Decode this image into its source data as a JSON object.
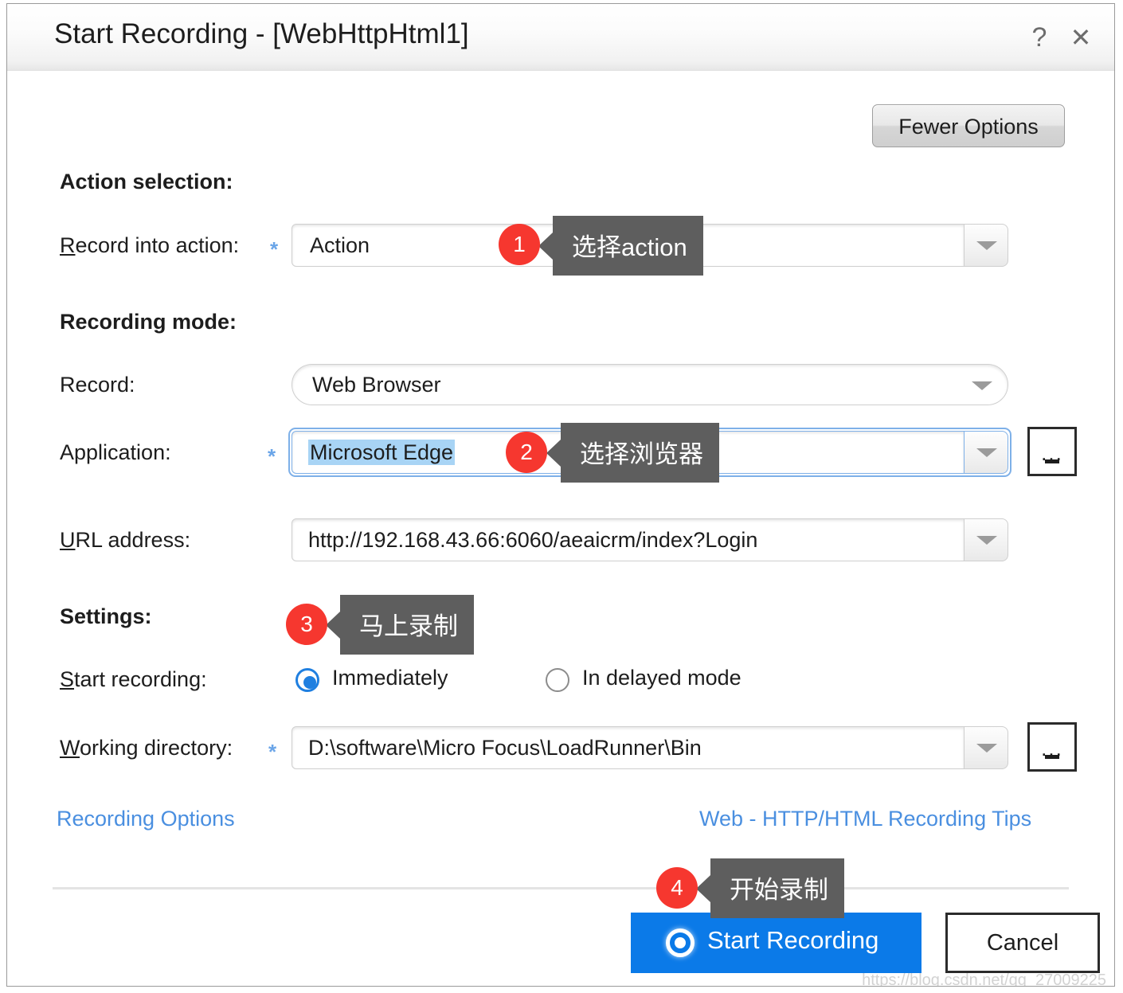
{
  "window": {
    "title": "Start Recording - [WebHttpHtml1]",
    "help_icon": "?",
    "close_icon": "✕"
  },
  "toolbar": {
    "fewer_options_label": "Fewer Options"
  },
  "sections": {
    "action_selection": {
      "heading": "Action selection:",
      "record_into_action": {
        "label_accesskey": "R",
        "label_rest": "ecord into action:",
        "required_marker": "*",
        "value": "Action"
      }
    },
    "recording_mode": {
      "heading": "Recording mode:",
      "record": {
        "label": "Record:",
        "value": "Web Browser"
      },
      "application": {
        "label": "Application:",
        "required_marker": "*",
        "value": "Microsoft Edge",
        "value_selected": true,
        "browse_label": "..."
      },
      "url_address": {
        "label_accesskey": "U",
        "label_rest": "RL address:",
        "value": "http://192.168.43.66:6060/aeaicrm/index?Login"
      }
    },
    "settings": {
      "heading": "Settings:",
      "start_recording": {
        "label_accesskey": "S",
        "label_rest": "tart recording:",
        "options": [
          {
            "label": "Immediately",
            "selected": true
          },
          {
            "label": "In delayed mode",
            "selected": false
          }
        ]
      },
      "working_directory": {
        "label_accesskey": "W",
        "label_rest": "orking directory:",
        "required_marker": "*",
        "value": "D:\\software\\Micro Focus\\LoadRunner\\Bin",
        "browse_label": "..."
      }
    }
  },
  "links": {
    "recording_options": "Recording Options",
    "recording_tips": "Web - HTTP/HTML Recording Tips"
  },
  "footer": {
    "start_recording_label": "Start Recording",
    "cancel_label": "Cancel"
  },
  "annotations": [
    {
      "number": "1",
      "text": "选择action"
    },
    {
      "number": "2",
      "text": "选择浏览器"
    },
    {
      "number": "3",
      "text": "马上录制"
    },
    {
      "number": "4",
      "text": "开始录制"
    }
  ],
  "watermark": "https://blog.csdn.net/qq_27009225",
  "colors": {
    "accent_blue": "#0b7ae8",
    "link_blue": "#4a8fe0",
    "badge_red": "#f6372f",
    "tooltip_gray": "#5e5e5e",
    "selection_blue": "#a8d4f5"
  }
}
